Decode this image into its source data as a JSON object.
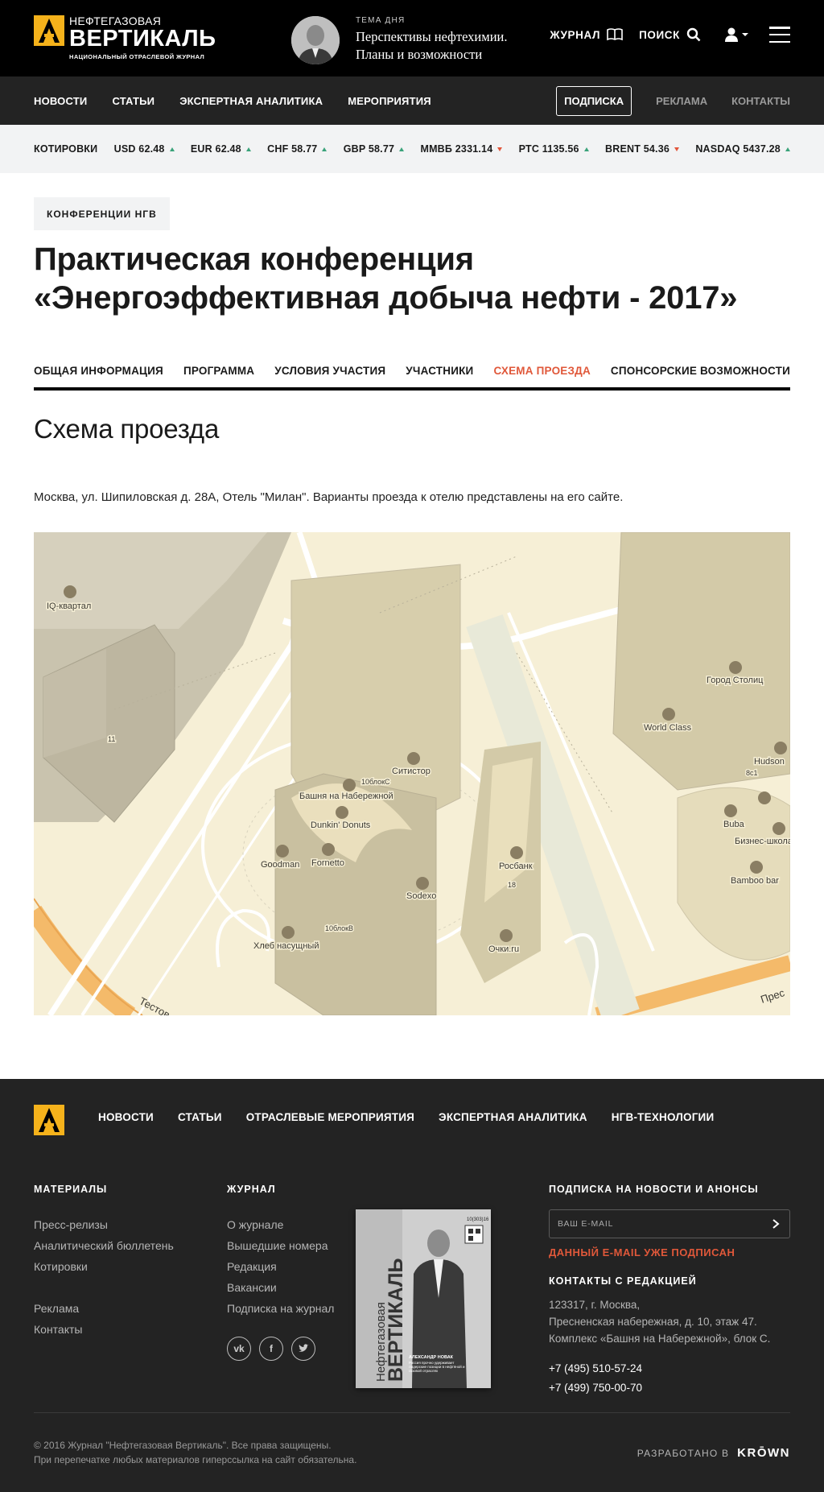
{
  "colors": {
    "accent": "#e0583a",
    "brand_yellow": "#f5b21b",
    "header_bg": "#000000",
    "nav_bg": "#232323",
    "quote_up": "#3aa37a",
    "quote_down": "#e2553a"
  },
  "header": {
    "logo": {
      "top": "НЕФТЕГАЗОВАЯ",
      "main": "ВЕРТИКАЛЬ",
      "sub": "НАЦИОНАЛЬНЫЙ ОТРАСЛЕВОЙ ЖУРНАЛ"
    },
    "topic": {
      "label": "ТЕМА ДНЯ",
      "title_line1": "Перспективы нефтехимии.",
      "title_line2": "Планы и возможности"
    },
    "journal_label": "ЖУРНАЛ",
    "search_label": "ПОИСК"
  },
  "nav": {
    "items": [
      "НОВОСТИ",
      "СТАТЬИ",
      "ЭКСПЕРТНАЯ АНАЛИТИКА",
      "МЕРОПРИЯТИЯ"
    ],
    "subscribe": "ПОДПИСКА",
    "ads": "РЕКЛАМА",
    "contacts": "КОНТАКТЫ"
  },
  "quotes": {
    "label": "КОТИРОВКИ",
    "items": [
      {
        "text": "USD 62.48",
        "trend": "up"
      },
      {
        "text": "EUR 62.48",
        "trend": "up"
      },
      {
        "text": "CHF 58.77",
        "trend": "up"
      },
      {
        "text": "GBP 58.77",
        "trend": "up"
      },
      {
        "text": "ММВБ 2331.14",
        "trend": "down"
      },
      {
        "text": "РТС 1135.56",
        "trend": "up"
      },
      {
        "text": "BRENT 54.36",
        "trend": "down"
      },
      {
        "text": "NASDAQ 5437.28",
        "trend": "up"
      }
    ]
  },
  "article": {
    "tag": "КОНФЕРЕНЦИИ НГВ",
    "title_line1": "Практическая конференция",
    "title_line2": "«Энергоэффективная добыча нефти - 2017»",
    "tabs": [
      {
        "label": "ОБЩАЯ ИНФОРМАЦИЯ",
        "active": false
      },
      {
        "label": "ПРОГРАММА",
        "active": false
      },
      {
        "label": "УСЛОВИЯ УЧАСТИЯ",
        "active": false
      },
      {
        "label": "УЧАСТНИКИ",
        "active": false
      },
      {
        "label": "СХЕМА ПРОЕЗДА",
        "active": true
      },
      {
        "label": "СПОНСОРСКИЕ ВОЗМОЖНОСТИ",
        "active": false
      }
    ],
    "section_title": "Схема проезда",
    "address": "Москва, ул. Шипиловская д. 28А, Отель \"Милан\". Варианты проезда к отелю представлены на его сайте."
  },
  "map": {
    "labels": {
      "iq": "IQ-квартал",
      "gorod": "Город Столиц",
      "worldclass": "World Class",
      "hudson": "Hudson",
      "8c1": "8с1",
      "sitistor": "Ситистор",
      "b10c": "10блокС",
      "bashnya": "Башня на Набережной",
      "dunkin": "Dunkin' Donuts",
      "buba": "Buba",
      "biznes": "Бизнес-школа",
      "goodman": "Goodman",
      "fornetto": "Fornetto",
      "rosbank": "Росбанк",
      "n18": "18",
      "sodexo": "Sodexo",
      "bamboo": "Bamboo bar",
      "n11": "11",
      "b10v": "10блокВ",
      "hleb": "Хлеб насущный",
      "ochki": "Очки.ru",
      "testov": "Тестов",
      "pres": "Прес"
    }
  },
  "footer": {
    "nav": [
      "НОВОСТИ",
      "СТАТЬИ",
      "ОТРАСЛЕВЫЕ МЕРОПРИЯТИЯ",
      "ЭКСПЕРТНАЯ АНАЛИТИКА",
      "НГВ-ТЕХНОЛОГИИ"
    ],
    "materials": {
      "title": "МАТЕРИАЛЫ",
      "links": [
        "Пресс-релизы",
        "Аналитический бюллетень",
        "Котировки"
      ],
      "links2": [
        "Реклама",
        "Контакты"
      ]
    },
    "journal": {
      "title": "ЖУРНАЛ",
      "links": [
        "О журнале",
        "Вышедшие номера",
        "Редакция",
        "Вакансии",
        "Подписка на журнал"
      ]
    },
    "cover": {
      "issue": "10(303)16",
      "brand_top": "Нефтегазовая",
      "brand_main": "ВЕРТИКАЛЬ",
      "person": "АЛЕКСАНДР НОВАК",
      "caption": "Россия прочно удерживает лидерские позиции в нефтяной и газовой отраслях"
    },
    "subscribe": {
      "title": "ПОДПИСКА НА НОВОСТИ И АНОНСЫ",
      "placeholder": "ВАШ E-MAIL",
      "error": "ДАННЫЙ E-MAIL УЖЕ ПОДПИСАН"
    },
    "contacts": {
      "title": "КОНТАКТЫ С РЕДАКЦИЕЙ",
      "address_line1": "123317, г. Москва,",
      "address_line2": "Пресненская набережная, д. 10, этаж 47.",
      "address_line3": "Комплекс «Башня на Набережной», блок С.",
      "phone1": "+7 (495) 510-57-24",
      "phone2": "+7 (499) 750-00-70"
    },
    "copyright_line1": "© 2016 Журнал \"Нефтегазовая Вертикаль\". Все права защищены.",
    "copyright_line2": "При перепечатке любых материалов гиперссылка на сайт обязательна.",
    "developed_by": "РАЗРАБОТАНО В",
    "developer": "KRŌWN"
  }
}
